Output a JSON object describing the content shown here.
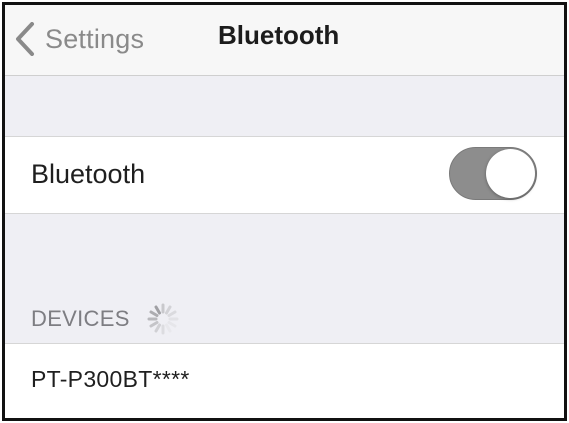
{
  "navbar": {
    "back_label": "Settings",
    "back_icon": "chevron-left-icon",
    "title": "Bluetooth"
  },
  "bluetooth_row": {
    "label": "Bluetooth",
    "toggle_on": true
  },
  "devices_section": {
    "header": "DEVICES",
    "spinner_icon": "loading-spinner-icon",
    "items": [
      {
        "label": "PT-P300BT****"
      }
    ]
  },
  "colors": {
    "toggle_track": "#8d8d8d",
    "knob": "#ffffff",
    "background": "#efeff4",
    "secondary_text": "#8a8a8a"
  }
}
